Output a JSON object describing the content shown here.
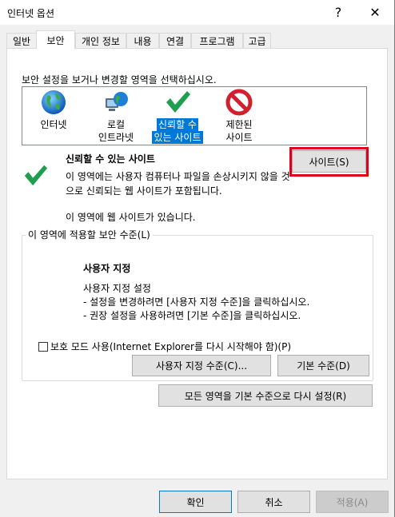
{
  "window": {
    "title": "인터넷 옵션",
    "help_label": "?",
    "close_label": "✕"
  },
  "tabs": [
    {
      "label": "일반"
    },
    {
      "label": "보안"
    },
    {
      "label": "개인 정보"
    },
    {
      "label": "내용"
    },
    {
      "label": "연결"
    },
    {
      "label": "프로그램"
    },
    {
      "label": "고급"
    }
  ],
  "security": {
    "select_zone_label": "보안 설정을 보거나 변경할 영역을 선택하십시오.",
    "zones": [
      {
        "label_1": "인터넷",
        "label_2": "",
        "icon": "globe-icon"
      },
      {
        "label_1": "로컬",
        "label_2": "인트라넷",
        "icon": "intranet-icon"
      },
      {
        "label_1": "신뢰할 수",
        "label_2": "있는 사이트",
        "icon": "checkmark-icon",
        "selected": true
      },
      {
        "label_1": "제한된",
        "label_2": "사이트",
        "icon": "restricted-icon"
      }
    ],
    "zone_title": "신뢰할 수 있는 사이트",
    "zone_desc": "이 영역에는 사용자 컴퓨터나 파일을 손상시키지 않을 것으로 신뢰되는 웹 사이트가 포함됩니다.",
    "zone_note": "이 영역에 웹 사이트가 있습니다.",
    "sites_button": "사이트(S)",
    "level_group_label": "이 영역에 적용할 보안 수준(L)",
    "level_title": "사용자 지정",
    "level_lines": [
      "사용자 지정 설정",
      "- 설정을 변경하려면 [사용자 지정 수준]을 클릭하십시오.",
      "- 권장 설정을 사용하려면 [기본 수준]을 클릭하십시오."
    ],
    "protected_mode_label": "보호 모드 사용(Internet Explorer를 다시 시작해야 함)(P)",
    "custom_level_button": "사용자 지정 수준(C)...",
    "default_level_button": "기본 수준(D)",
    "reset_all_button": "모든 영역을 기본 수준으로 다시 설정(R)"
  },
  "footer": {
    "ok": "확인",
    "cancel": "취소",
    "apply": "적용(A)"
  },
  "colors": {
    "selection": "#0078d7",
    "highlight_box": "#e0001b"
  }
}
